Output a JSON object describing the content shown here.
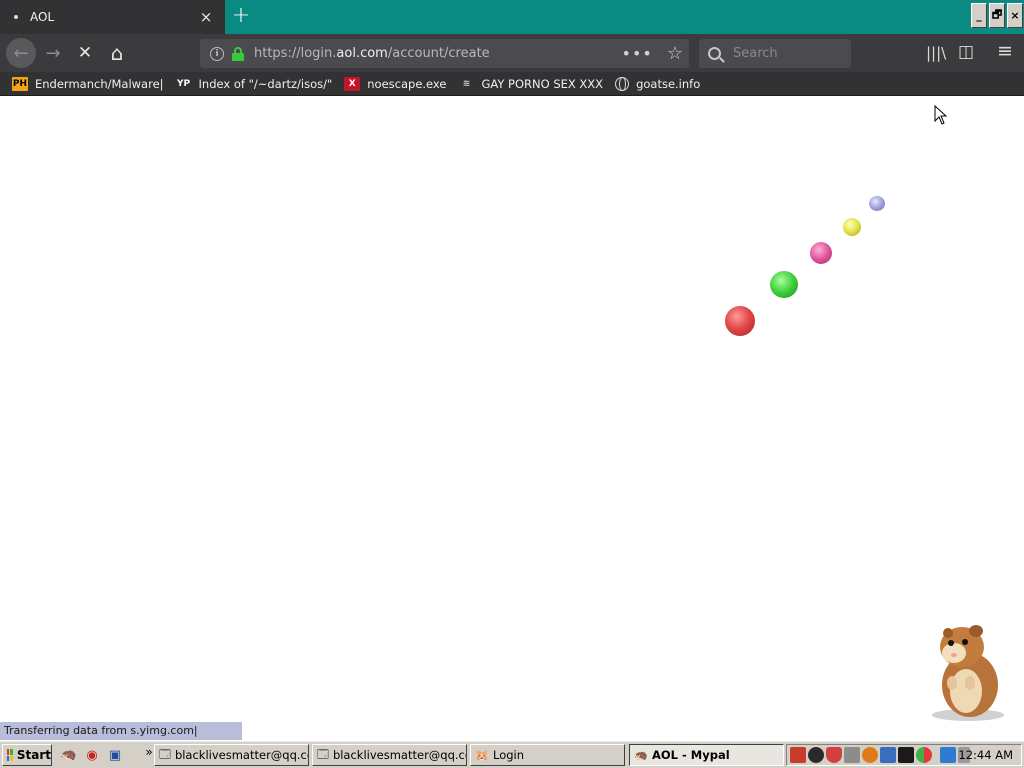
{
  "tab": {
    "title": "AOL",
    "close": "×"
  },
  "newtab": "+",
  "window_controls": [
    "_",
    "🗗",
    "×"
  ],
  "nav": {
    "back": "←",
    "forward": "→",
    "stop": "✕",
    "home": "⌂",
    "url_prefix": "https://login.",
    "url_host": "aol.com",
    "url_path": "/account/create",
    "page_actions": "•••",
    "bookmark_star": "☆",
    "search_placeholder": "Search",
    "library": "|||\\",
    "sidebar": "◫",
    "menu": "≡"
  },
  "bookmarks": [
    {
      "icon": "PH",
      "label": "Endermanch/Malware|"
    },
    {
      "icon": "YP",
      "label": "Index of \"/~dartz/isos/\""
    },
    {
      "icon": "X",
      "label": "noescape.exe"
    },
    {
      "icon": "≋",
      "label": "GAY PORNO SEX XXX"
    },
    {
      "icon": "",
      "label": "goatse.info"
    }
  ],
  "status_text": "Transferring data from s.yimg.com|",
  "taskbar": {
    "start": "Start",
    "chevron": "»",
    "buttons": [
      {
        "label": "blacklivesmatter@qq.com",
        "icon": "🗔"
      },
      {
        "label": "blacklivesmatter@qq.com",
        "icon": "🗔"
      },
      {
        "label": "Login",
        "icon": "🐹"
      },
      {
        "label": "AOL - Mypal",
        "icon": "🦔"
      }
    ],
    "clock": "12:44 AM"
  }
}
